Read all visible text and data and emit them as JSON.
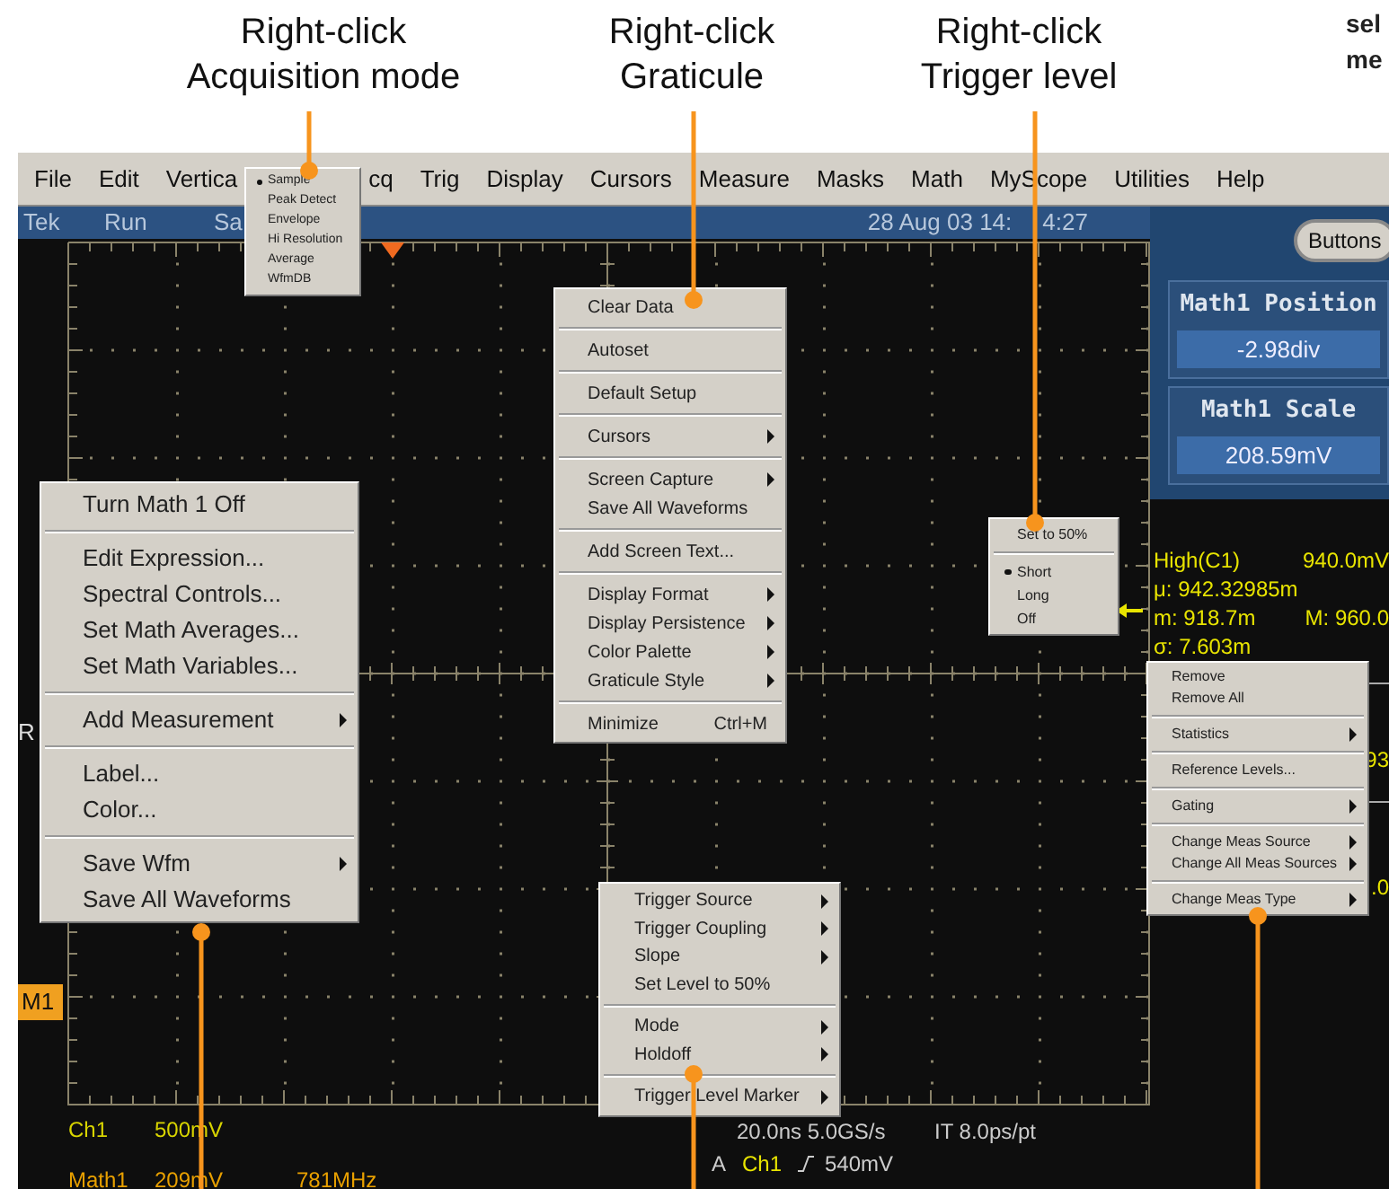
{
  "callouts": [
    {
      "lines": [
        "Right-click",
        "Acquisition mode"
      ]
    },
    {
      "lines": [
        "Right-click",
        "Graticule"
      ]
    },
    {
      "lines": [
        "Right-click",
        "Trigger level"
      ]
    }
  ],
  "cut_caption": {
    "lines": [
      "sel",
      "me"
    ]
  },
  "menu_bar": [
    "File",
    "Edit",
    "Vertica",
    "cq",
    "Trig",
    "Display",
    "Cursors",
    "Measure",
    "Masks",
    "Math",
    "MyScope",
    "Utilities",
    "Help"
  ],
  "status_bar": {
    "brand": "Tek",
    "state": "Run",
    "mode": "Sa",
    "date_parts": [
      "28 Aug 03 14:",
      "4:27"
    ]
  },
  "buttons_button": "Buttons",
  "control_panels": [
    {
      "title": "Math1 Position",
      "value": "-2.98div"
    },
    {
      "title": "Math1 Scale",
      "value": "208.59mV"
    }
  ],
  "measurement_rows": [
    [
      "High(C1)",
      "940.0mV"
    ],
    [
      "μ: 942.32985m"
    ],
    [
      "m: 918.7m",
      "M: 960.0"
    ],
    [
      "σ: 7.603m"
    ]
  ],
  "hidden_readouts": [
    "93",
    ".0"
  ],
  "markers": {
    "reference": "R",
    "math": "M1"
  },
  "channel_readouts": [
    {
      "texts": [
        "Ch1",
        "500mV"
      ],
      "color": "#d8d400"
    },
    {
      "texts": [
        "Math1",
        "209mV",
        "781MHz"
      ],
      "color": "#e8a000"
    }
  ],
  "timebase": {
    "rate": "20.0ns 5.0GS/s",
    "record": "IT 8.0ps/pt"
  },
  "trigger_readout": {
    "prefix": "A",
    "source": "Ch1",
    "level": "540mV"
  },
  "acquisition_menu": {
    "groups": [
      [
        {
          "label": "Sample",
          "selected": true
        },
        {
          "label": "Peak Detect",
          "selected": false
        },
        {
          "label": "Envelope",
          "selected": false
        },
        {
          "label": "Hi Resolution",
          "selected": false
        },
        {
          "label": "Average",
          "selected": false
        },
        {
          "label": "WfmDB",
          "selected": false
        }
      ]
    ]
  },
  "graticule_menu": {
    "groups": [
      [
        {
          "label": "Clear Data",
          "submenu": false
        }
      ],
      [
        {
          "label": "Autoset",
          "submenu": false
        }
      ],
      [
        {
          "label": "Default Setup",
          "submenu": false
        }
      ],
      [
        {
          "label": "Cursors",
          "submenu": true
        }
      ],
      [
        {
          "label": "Screen Capture",
          "submenu": true
        },
        {
          "label": "Save All Waveforms",
          "submenu": false
        }
      ],
      [
        {
          "label": "Add Screen Text...",
          "submenu": false
        }
      ],
      [
        {
          "label": "Display Format",
          "submenu": true
        },
        {
          "label": "Display Persistence",
          "submenu": true
        },
        {
          "label": "Color Palette",
          "submenu": true
        },
        {
          "label": "Graticule Style",
          "submenu": true
        }
      ],
      [
        {
          "label": "Minimize",
          "shortcut": "Ctrl+M",
          "submenu": false
        }
      ]
    ]
  },
  "math_menu": {
    "groups": [
      [
        {
          "label": "Turn Math 1 Off",
          "submenu": false
        }
      ],
      [
        {
          "label": "Edit Expression...",
          "submenu": false
        },
        {
          "label": "Spectral Controls...",
          "submenu": false
        },
        {
          "label": "Set Math Averages...",
          "submenu": false
        },
        {
          "label": "Set Math Variables...",
          "submenu": false
        }
      ],
      [
        {
          "label": "Add Measurement",
          "submenu": true
        }
      ],
      [
        {
          "label": "Label...",
          "submenu": false
        },
        {
          "label": "Color...",
          "submenu": false
        }
      ],
      [
        {
          "label": "Save Wfm",
          "submenu": true
        },
        {
          "label": "Save All Waveforms",
          "submenu": false
        }
      ]
    ]
  },
  "trigger_level_menu": {
    "groups": [
      [
        {
          "label": "Set to 50%"
        }
      ],
      [
        {
          "label": "Short",
          "selected": true
        },
        {
          "label": "Long",
          "selected": false
        },
        {
          "label": "Off",
          "selected": false
        }
      ]
    ]
  },
  "measurement_menu": {
    "groups": [
      [
        {
          "label": "Remove",
          "submenu": false
        },
        {
          "label": "Remove All",
          "submenu": false
        }
      ],
      [
        {
          "label": "Statistics",
          "submenu": true
        }
      ],
      [
        {
          "label": "Reference Levels...",
          "submenu": false
        }
      ],
      [
        {
          "label": "Gating",
          "submenu": true
        }
      ],
      [
        {
          "label": "Change Meas Source",
          "submenu": true
        },
        {
          "label": "Change All Meas Sources",
          "submenu": true
        }
      ],
      [
        {
          "label": "Change Meas Type",
          "submenu": true
        }
      ]
    ]
  },
  "trigger_menu": {
    "groups": [
      [
        {
          "label": "Trigger Source",
          "submenu": true
        },
        {
          "label": "Trigger Coupling",
          "submenu": true
        },
        {
          "label": "Slope",
          "submenu": true
        },
        {
          "label": "Set Level to 50%",
          "submenu": false
        }
      ],
      [
        {
          "label": "Mode",
          "submenu": true
        },
        {
          "label": "Holdoff",
          "submenu": true
        }
      ],
      [
        {
          "label": "Trigger Level Marker",
          "submenu": true
        }
      ]
    ]
  }
}
